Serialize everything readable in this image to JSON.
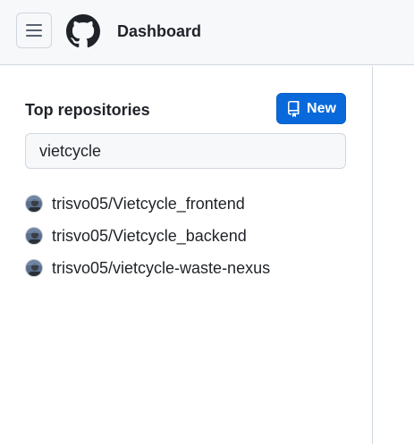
{
  "header": {
    "title": "Dashboard",
    "menu_icon": "hamburger-icon",
    "logo_icon": "github-logo-icon"
  },
  "sidebar": {
    "section_title": "Top repositories",
    "new_button": {
      "label": "New",
      "icon": "repo-icon"
    },
    "search": {
      "value": "vietcycle",
      "placeholder": ""
    },
    "repos": [
      {
        "name": "trisvo05/Vietcycle_frontend"
      },
      {
        "name": "trisvo05/Vietcycle_backend"
      },
      {
        "name": "trisvo05/vietcycle-waste-nexus"
      }
    ]
  },
  "colors": {
    "accent": "#0969da",
    "header_bg": "#f6f8fa",
    "border": "#d0d7de",
    "text": "#1f2328"
  }
}
